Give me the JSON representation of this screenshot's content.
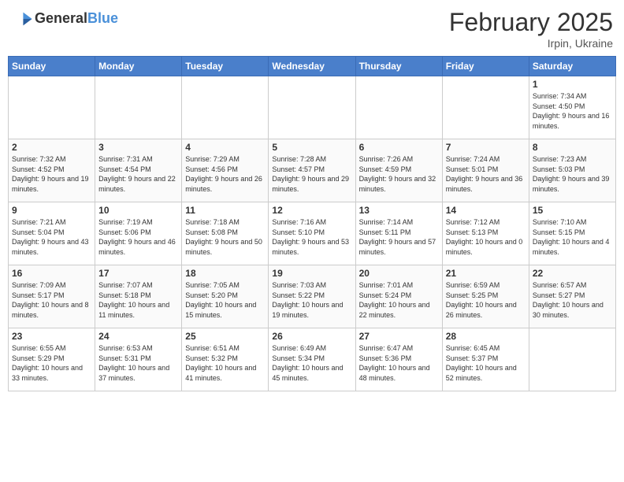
{
  "header": {
    "logo_general": "General",
    "logo_blue": "Blue",
    "month": "February 2025",
    "location": "Irpin, Ukraine"
  },
  "weekdays": [
    "Sunday",
    "Monday",
    "Tuesday",
    "Wednesday",
    "Thursday",
    "Friday",
    "Saturday"
  ],
  "weeks": [
    [
      {
        "day": "",
        "info": ""
      },
      {
        "day": "",
        "info": ""
      },
      {
        "day": "",
        "info": ""
      },
      {
        "day": "",
        "info": ""
      },
      {
        "day": "",
        "info": ""
      },
      {
        "day": "",
        "info": ""
      },
      {
        "day": "1",
        "info": "Sunrise: 7:34 AM\nSunset: 4:50 PM\nDaylight: 9 hours and 16 minutes."
      }
    ],
    [
      {
        "day": "2",
        "info": "Sunrise: 7:32 AM\nSunset: 4:52 PM\nDaylight: 9 hours and 19 minutes."
      },
      {
        "day": "3",
        "info": "Sunrise: 7:31 AM\nSunset: 4:54 PM\nDaylight: 9 hours and 22 minutes."
      },
      {
        "day": "4",
        "info": "Sunrise: 7:29 AM\nSunset: 4:56 PM\nDaylight: 9 hours and 26 minutes."
      },
      {
        "day": "5",
        "info": "Sunrise: 7:28 AM\nSunset: 4:57 PM\nDaylight: 9 hours and 29 minutes."
      },
      {
        "day": "6",
        "info": "Sunrise: 7:26 AM\nSunset: 4:59 PM\nDaylight: 9 hours and 32 minutes."
      },
      {
        "day": "7",
        "info": "Sunrise: 7:24 AM\nSunset: 5:01 PM\nDaylight: 9 hours and 36 minutes."
      },
      {
        "day": "8",
        "info": "Sunrise: 7:23 AM\nSunset: 5:03 PM\nDaylight: 9 hours and 39 minutes."
      }
    ],
    [
      {
        "day": "9",
        "info": "Sunrise: 7:21 AM\nSunset: 5:04 PM\nDaylight: 9 hours and 43 minutes."
      },
      {
        "day": "10",
        "info": "Sunrise: 7:19 AM\nSunset: 5:06 PM\nDaylight: 9 hours and 46 minutes."
      },
      {
        "day": "11",
        "info": "Sunrise: 7:18 AM\nSunset: 5:08 PM\nDaylight: 9 hours and 50 minutes."
      },
      {
        "day": "12",
        "info": "Sunrise: 7:16 AM\nSunset: 5:10 PM\nDaylight: 9 hours and 53 minutes."
      },
      {
        "day": "13",
        "info": "Sunrise: 7:14 AM\nSunset: 5:11 PM\nDaylight: 9 hours and 57 minutes."
      },
      {
        "day": "14",
        "info": "Sunrise: 7:12 AM\nSunset: 5:13 PM\nDaylight: 10 hours and 0 minutes."
      },
      {
        "day": "15",
        "info": "Sunrise: 7:10 AM\nSunset: 5:15 PM\nDaylight: 10 hours and 4 minutes."
      }
    ],
    [
      {
        "day": "16",
        "info": "Sunrise: 7:09 AM\nSunset: 5:17 PM\nDaylight: 10 hours and 8 minutes."
      },
      {
        "day": "17",
        "info": "Sunrise: 7:07 AM\nSunset: 5:18 PM\nDaylight: 10 hours and 11 minutes."
      },
      {
        "day": "18",
        "info": "Sunrise: 7:05 AM\nSunset: 5:20 PM\nDaylight: 10 hours and 15 minutes."
      },
      {
        "day": "19",
        "info": "Sunrise: 7:03 AM\nSunset: 5:22 PM\nDaylight: 10 hours and 19 minutes."
      },
      {
        "day": "20",
        "info": "Sunrise: 7:01 AM\nSunset: 5:24 PM\nDaylight: 10 hours and 22 minutes."
      },
      {
        "day": "21",
        "info": "Sunrise: 6:59 AM\nSunset: 5:25 PM\nDaylight: 10 hours and 26 minutes."
      },
      {
        "day": "22",
        "info": "Sunrise: 6:57 AM\nSunset: 5:27 PM\nDaylight: 10 hours and 30 minutes."
      }
    ],
    [
      {
        "day": "23",
        "info": "Sunrise: 6:55 AM\nSunset: 5:29 PM\nDaylight: 10 hours and 33 minutes."
      },
      {
        "day": "24",
        "info": "Sunrise: 6:53 AM\nSunset: 5:31 PM\nDaylight: 10 hours and 37 minutes."
      },
      {
        "day": "25",
        "info": "Sunrise: 6:51 AM\nSunset: 5:32 PM\nDaylight: 10 hours and 41 minutes."
      },
      {
        "day": "26",
        "info": "Sunrise: 6:49 AM\nSunset: 5:34 PM\nDaylight: 10 hours and 45 minutes."
      },
      {
        "day": "27",
        "info": "Sunrise: 6:47 AM\nSunset: 5:36 PM\nDaylight: 10 hours and 48 minutes."
      },
      {
        "day": "28",
        "info": "Sunrise: 6:45 AM\nSunset: 5:37 PM\nDaylight: 10 hours and 52 minutes."
      },
      {
        "day": "",
        "info": ""
      }
    ]
  ]
}
